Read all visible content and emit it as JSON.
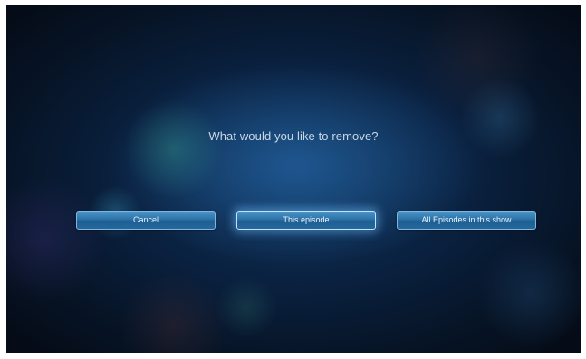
{
  "dialog": {
    "prompt": "What would you like to remove?",
    "buttons": {
      "cancel_label": "Cancel",
      "episode_label": "This episode",
      "all_label": "All Episodes in this show"
    },
    "focused_button": "This episode"
  },
  "colors": {
    "background": "#0a2140",
    "button": "#2d73a8",
    "button_border": "#7fb6dd",
    "focus_glow": "#6ebeff",
    "text": "#c9d8e6"
  }
}
